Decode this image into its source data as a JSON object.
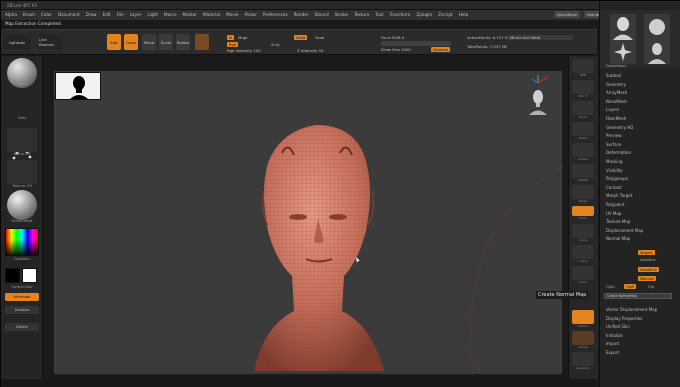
{
  "titlebar": {
    "app_title": "ZBrush 4R7 P3"
  },
  "menu": {
    "items": [
      "Alpha",
      "Brush",
      "Color",
      "Document",
      "Draw",
      "Edit",
      "File",
      "Layer",
      "Light",
      "Macro",
      "Marker",
      "Material",
      "Movie",
      "Picker",
      "Preferences",
      "Render",
      "Stencil",
      "Stroke",
      "Texture",
      "Tool",
      "Transform",
      "Zplugin",
      "Zscript",
      "Help"
    ],
    "right_items": [
      "QuickSave",
      "See-through 0",
      "Menus",
      "DefaultZScript"
    ]
  },
  "note": "Map Extraction Completed.",
  "toolbar": {
    "lightbox": "Lightbox",
    "liveboolean": "Live Boolean",
    "buttons": [
      "Edit",
      "Draw",
      "Move",
      "Scale",
      "Rotate"
    ],
    "mrgb": "Mrgb",
    "rgb": "Rgb",
    "m": "M",
    "zadd": "Zadd",
    "zsub": "Zsub",
    "zcut": "Zcut",
    "rgb_intensity": "Rgb Intensity 100",
    "z_intensity": "Z Intensity 50",
    "focal_shift": "Focal Shift 0",
    "draw_size": "Draw Size 1000",
    "dynamic": "Dynamic",
    "active_points": "ActivePoints: 6.137 Mil",
    "total_points": "TotalPoints: 7.037 Mil",
    "mirror_weld": "Mirror And Weld"
  },
  "leftshelf": {
    "brush": "Move",
    "stroke": "Dots",
    "alpha": "Alpha Off",
    "texture": "Texture Off",
    "material": "SkinShade4",
    "gradient": "Gradient",
    "switch_color": "SwitchColor",
    "alternate": "Alternate",
    "doubles": "Doubles",
    "delete": "Delete"
  },
  "rightshelf": {
    "labels": [
      "BPR",
      "SPix 3",
      "Scroll",
      "Zoom",
      "Actual",
      "AAHalf",
      "Persp",
      "Floor",
      "Local",
      "L.Sym",
      "Gxyz",
      "Frame",
      "Move",
      "Scale",
      "Rotate",
      "Line Fill PolyF",
      "Transp",
      "Dynamic",
      "Solo",
      "Xpose"
    ]
  },
  "tooltip": "Create Normal Map",
  "rightpanel": {
    "tool_thumbs": [
      "PM3D_Sphere3D",
      "SimpleBrush",
      "EraserBrush",
      "PM3D_Sphere3D_1"
    ],
    "current_tool": "DemoHead",
    "items": [
      "Subtool",
      "Geometry",
      "ArrayMesh",
      "NanoMesh",
      "Layers",
      "FiberMesh",
      "Geometry HD",
      "Preview",
      "Surface",
      "Deformation",
      "Masking",
      "Visibility",
      "Polygroups",
      "Contact",
      "Morph Target",
      "Polypaint",
      "UV Map",
      "Texture Map",
      "Displacement Map",
      "Normal Map"
    ],
    "normal_map": {
      "tangent": "Tangent",
      "adaptive": "Adaptive",
      "smooth_uv": "SmoothUV",
      "seam_overdraw": "SNormal",
      "flip_g": "FlipG",
      "flip_r": "FlipR",
      "sub_vector": "SubVector",
      "create_button": "Create NormalMap",
      "clone_nm": "Clone NM",
      "flip": "Flip"
    },
    "items_after": [
      "Vector Displacement Map",
      "Display Properties",
      "Unified Skin",
      "Initialize",
      "Import",
      "Export"
    ]
  }
}
